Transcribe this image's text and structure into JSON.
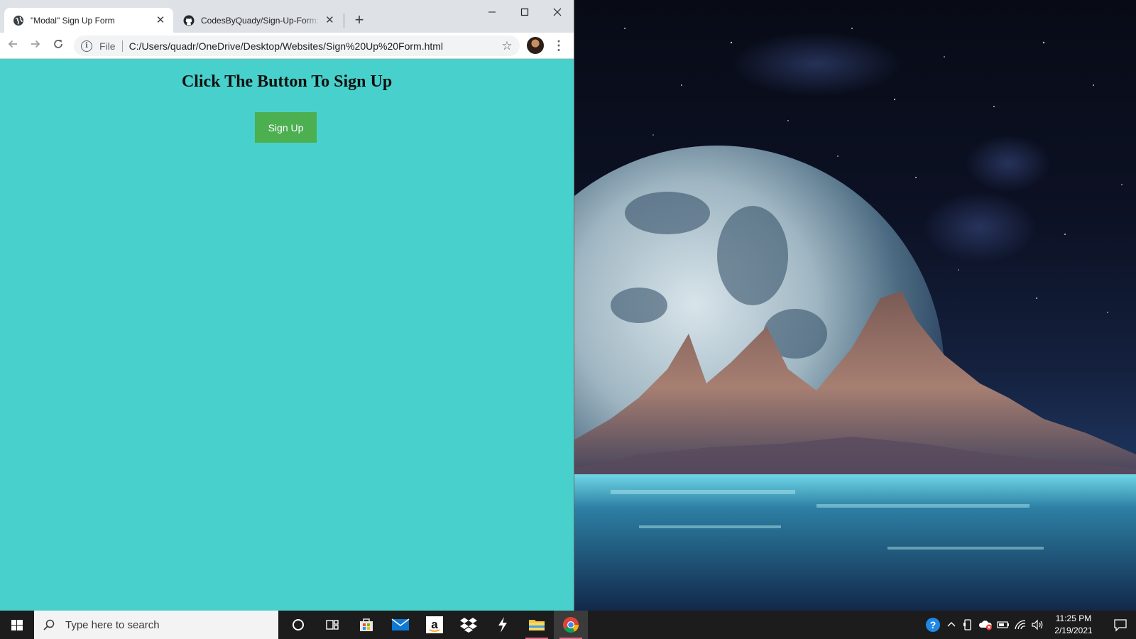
{
  "browser": {
    "tabs": [
      {
        "title": "\"Modal\" Sign Up Form",
        "favicon": "globe-icon",
        "active": true
      },
      {
        "title": "CodesByQuady/Sign-Up-Form: A",
        "favicon": "github-icon",
        "active": false
      }
    ],
    "new_tab_label": "+",
    "window_controls": {
      "minimize": "—",
      "maximize": "☐",
      "close": "✕"
    },
    "toolbar": {
      "scheme_label": "File",
      "url": "C:/Users/quadr/OneDrive/Desktop/Websites/Sign%20Up%20Form.html"
    }
  },
  "page": {
    "heading": "Click The Button To Sign Up",
    "signup_button": "Sign Up",
    "background_color": "#48d1cc",
    "button_color": "#4caf50"
  },
  "taskbar": {
    "search_placeholder": "Type here to search",
    "apps": [
      "cortana-icon",
      "task-view-icon",
      "store-icon",
      "mail-icon",
      "amazon-icon",
      "dropbox-icon",
      "winamp-icon",
      "file-explorer-icon",
      "chrome-icon"
    ],
    "amazon_letter": "a",
    "clock": {
      "time": "11:25 PM",
      "date": "2/19/2021"
    }
  }
}
